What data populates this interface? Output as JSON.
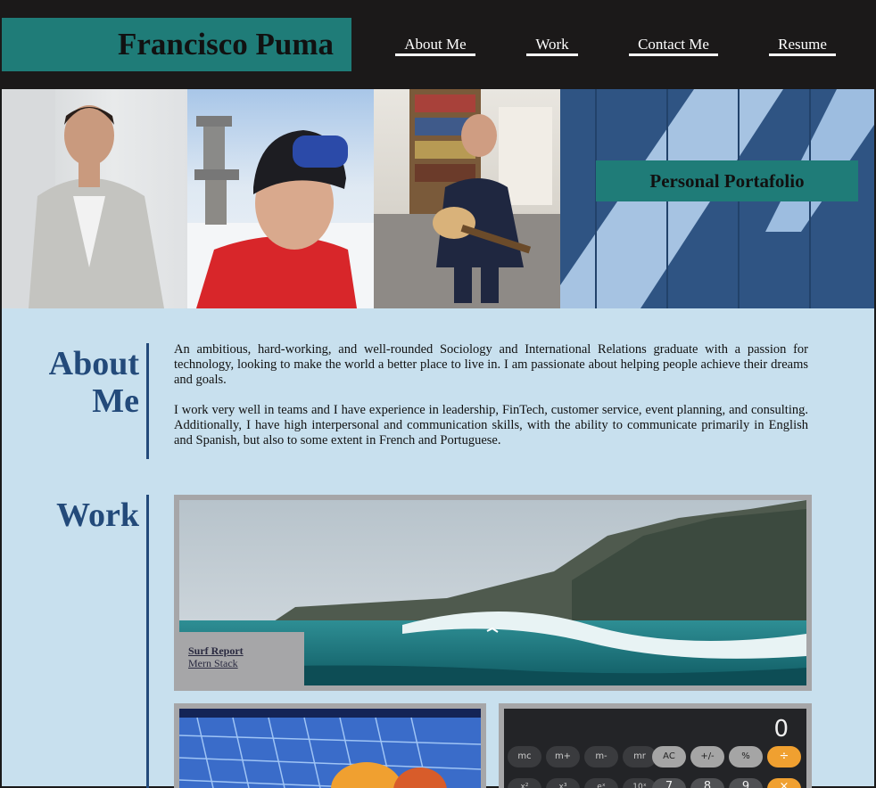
{
  "header": {
    "brand": "Francisco Puma",
    "nav": [
      "About Me",
      "Work",
      "Contact Me",
      "Resume"
    ]
  },
  "hero": {
    "badge": "Personal Portafolio"
  },
  "about": {
    "title_line1": "About",
    "title_line2": "Me",
    "paragraphs": [
      "An ambitious, hard-working, and well-rounded Sociology and International Relations graduate with a passion for technology, looking to make the world a better place to live in. I am passionate about helping people achieve their dreams and goals.",
      "I work very well in teams and I have experience in leadership, FinTech, customer service, event planning, and consulting. Additionally, I have high interpersonal and communication skills, with the ability to communicate primarily in English and Spanish, but also to some extent in French and Portuguese."
    ]
  },
  "work": {
    "title": "Work",
    "featured": {
      "title": "Surf Report",
      "tech": "Mern Stack"
    },
    "calculator": {
      "display": "0",
      "row1": [
        "mc",
        "m+",
        "m-",
        "mr",
        "AC",
        "+/-",
        "%",
        "÷"
      ],
      "row2": [
        "x²",
        "x³",
        "eˣ",
        "10ˣ",
        "7",
        "8",
        "9",
        "×"
      ]
    }
  },
  "colors": {
    "header_bg": "#1b1919",
    "teal": "#1f7c78",
    "page_bg": "#c8e0ee",
    "accent_blue": "#234a7a"
  }
}
